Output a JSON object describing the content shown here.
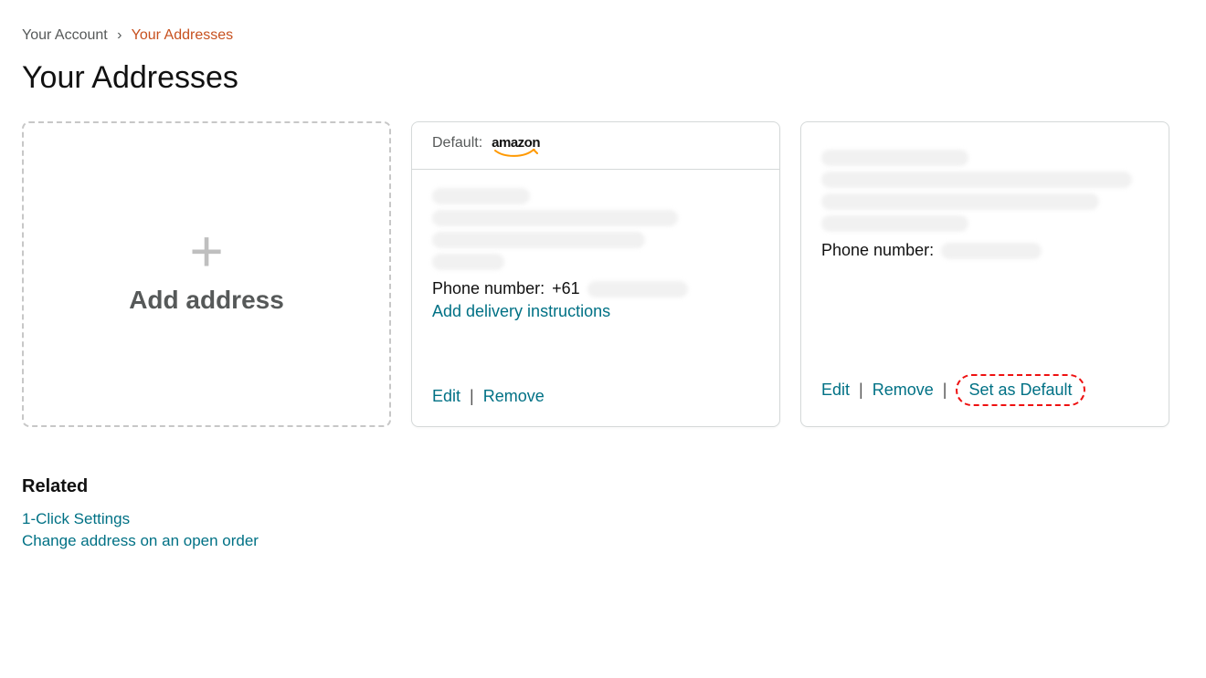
{
  "breadcrumb": {
    "account": "Your Account",
    "sep": "›",
    "current": "Your Addresses"
  },
  "page_title": "Your Addresses",
  "add_tile": {
    "label": "Add address"
  },
  "address1": {
    "default_label": "Default:",
    "logo_name": "amazon",
    "phone_label": "Phone number:",
    "phone_prefix": "+61",
    "delivery_instructions": "Add delivery instructions",
    "actions": {
      "edit": "Edit",
      "remove": "Remove"
    },
    "sep": "|"
  },
  "address2": {
    "phone_label": "Phone number:",
    "actions": {
      "edit": "Edit",
      "remove": "Remove",
      "set_default": "Set as Default"
    },
    "sep": "|"
  },
  "related": {
    "heading": "Related",
    "links": {
      "one_click": "1-Click Settings",
      "change_order_address": "Change address on an open order"
    }
  }
}
